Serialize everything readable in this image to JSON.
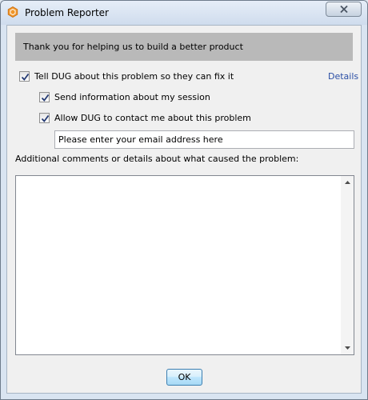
{
  "window": {
    "title": "Problem Reporter",
    "app_icon": "orange-hexagon-icon"
  },
  "banner": {
    "text": "Thank you for helping us to build a better product"
  },
  "options": {
    "tell_dug": {
      "label": "Tell DUG about this problem so they can fix it",
      "checked": true
    },
    "send_session": {
      "label": "Send information about my session",
      "checked": true
    },
    "allow_contact": {
      "label": "Allow DUG to contact me about this problem",
      "checked": true
    }
  },
  "details_link": "Details",
  "email": {
    "placeholder": "Please enter your email address here",
    "value": ""
  },
  "comments": {
    "label": "Additional comments or details about what caused the problem:",
    "value": ""
  },
  "ok_label": "OK",
  "colors": {
    "banner_bg": "#b9b9b9",
    "link": "#2a4ea5",
    "app_icon": "#f0962a"
  }
}
